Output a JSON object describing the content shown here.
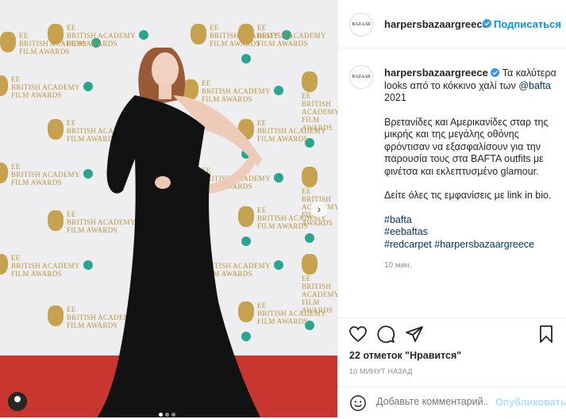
{
  "post": {
    "username": "harpersbazaargreece",
    "avatar_text": "BAZAAR",
    "follow_label": "Подписаться",
    "verified_icon": "verified-badge-icon",
    "caption_line1": "Τα καλύτερα looks από το κόκκινο χαλί των",
    "caption_mention": "@bafta",
    "caption_year": " 2021",
    "caption_para2": "Βρετανίδες και Αμερικανίδες σταρ της μικρής και της μεγάλης οθόνης φρόντισαν να εξασφαλίσουν για την παρουσία τους στα BAFTA outfits με φινέτσα και εκλεπτυσμένο glamour.",
    "caption_para3": "Δείτε όλες τις εμφανίσεις με link in bio.",
    "hashtags": [
      "#bafta",
      "#eebaftas",
      "#redcarpet",
      "#harpersbazaargreece"
    ],
    "caption_time": "10 мин.",
    "likes": "22 отметок \"Нравится\"",
    "posted_ago": "10 МИНУТ НАЗАД",
    "comment_placeholder": "Добавьте комментарий...",
    "publish_label": "Опубликовать"
  },
  "photo": {
    "backdrop_text_line1": "BRITISH ACADEMY",
    "backdrop_text_line2": "FILM AWARDS",
    "backdrop_ee": "EE",
    "carousel_count": 3,
    "carousel_active": 0
  },
  "colors": {
    "accent": "#0095f6",
    "link": "#00376b",
    "carpet": "#c9352f",
    "dress": "#121212"
  }
}
